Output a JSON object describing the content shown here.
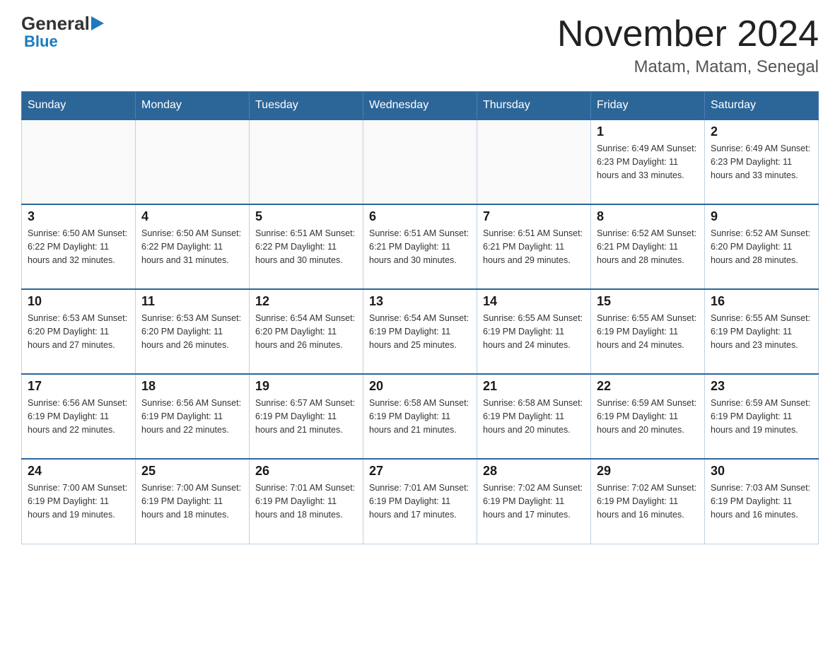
{
  "logo": {
    "general": "General",
    "blue": "Blue",
    "arrow_unicode": "▶"
  },
  "title": "November 2024",
  "subtitle": "Matam, Matam, Senegal",
  "weekdays": [
    "Sunday",
    "Monday",
    "Tuesday",
    "Wednesday",
    "Thursday",
    "Friday",
    "Saturday"
  ],
  "weeks": [
    {
      "days": [
        {
          "num": "",
          "info": ""
        },
        {
          "num": "",
          "info": ""
        },
        {
          "num": "",
          "info": ""
        },
        {
          "num": "",
          "info": ""
        },
        {
          "num": "",
          "info": ""
        },
        {
          "num": "1",
          "info": "Sunrise: 6:49 AM\nSunset: 6:23 PM\nDaylight: 11 hours and 33 minutes."
        },
        {
          "num": "2",
          "info": "Sunrise: 6:49 AM\nSunset: 6:23 PM\nDaylight: 11 hours and 33 minutes."
        }
      ]
    },
    {
      "days": [
        {
          "num": "3",
          "info": "Sunrise: 6:50 AM\nSunset: 6:22 PM\nDaylight: 11 hours and 32 minutes."
        },
        {
          "num": "4",
          "info": "Sunrise: 6:50 AM\nSunset: 6:22 PM\nDaylight: 11 hours and 31 minutes."
        },
        {
          "num": "5",
          "info": "Sunrise: 6:51 AM\nSunset: 6:22 PM\nDaylight: 11 hours and 30 minutes."
        },
        {
          "num": "6",
          "info": "Sunrise: 6:51 AM\nSunset: 6:21 PM\nDaylight: 11 hours and 30 minutes."
        },
        {
          "num": "7",
          "info": "Sunrise: 6:51 AM\nSunset: 6:21 PM\nDaylight: 11 hours and 29 minutes."
        },
        {
          "num": "8",
          "info": "Sunrise: 6:52 AM\nSunset: 6:21 PM\nDaylight: 11 hours and 28 minutes."
        },
        {
          "num": "9",
          "info": "Sunrise: 6:52 AM\nSunset: 6:20 PM\nDaylight: 11 hours and 28 minutes."
        }
      ]
    },
    {
      "days": [
        {
          "num": "10",
          "info": "Sunrise: 6:53 AM\nSunset: 6:20 PM\nDaylight: 11 hours and 27 minutes."
        },
        {
          "num": "11",
          "info": "Sunrise: 6:53 AM\nSunset: 6:20 PM\nDaylight: 11 hours and 26 minutes."
        },
        {
          "num": "12",
          "info": "Sunrise: 6:54 AM\nSunset: 6:20 PM\nDaylight: 11 hours and 26 minutes."
        },
        {
          "num": "13",
          "info": "Sunrise: 6:54 AM\nSunset: 6:19 PM\nDaylight: 11 hours and 25 minutes."
        },
        {
          "num": "14",
          "info": "Sunrise: 6:55 AM\nSunset: 6:19 PM\nDaylight: 11 hours and 24 minutes."
        },
        {
          "num": "15",
          "info": "Sunrise: 6:55 AM\nSunset: 6:19 PM\nDaylight: 11 hours and 24 minutes."
        },
        {
          "num": "16",
          "info": "Sunrise: 6:55 AM\nSunset: 6:19 PM\nDaylight: 11 hours and 23 minutes."
        }
      ]
    },
    {
      "days": [
        {
          "num": "17",
          "info": "Sunrise: 6:56 AM\nSunset: 6:19 PM\nDaylight: 11 hours and 22 minutes."
        },
        {
          "num": "18",
          "info": "Sunrise: 6:56 AM\nSunset: 6:19 PM\nDaylight: 11 hours and 22 minutes."
        },
        {
          "num": "19",
          "info": "Sunrise: 6:57 AM\nSunset: 6:19 PM\nDaylight: 11 hours and 21 minutes."
        },
        {
          "num": "20",
          "info": "Sunrise: 6:58 AM\nSunset: 6:19 PM\nDaylight: 11 hours and 21 minutes."
        },
        {
          "num": "21",
          "info": "Sunrise: 6:58 AM\nSunset: 6:19 PM\nDaylight: 11 hours and 20 minutes."
        },
        {
          "num": "22",
          "info": "Sunrise: 6:59 AM\nSunset: 6:19 PM\nDaylight: 11 hours and 20 minutes."
        },
        {
          "num": "23",
          "info": "Sunrise: 6:59 AM\nSunset: 6:19 PM\nDaylight: 11 hours and 19 minutes."
        }
      ]
    },
    {
      "days": [
        {
          "num": "24",
          "info": "Sunrise: 7:00 AM\nSunset: 6:19 PM\nDaylight: 11 hours and 19 minutes."
        },
        {
          "num": "25",
          "info": "Sunrise: 7:00 AM\nSunset: 6:19 PM\nDaylight: 11 hours and 18 minutes."
        },
        {
          "num": "26",
          "info": "Sunrise: 7:01 AM\nSunset: 6:19 PM\nDaylight: 11 hours and 18 minutes."
        },
        {
          "num": "27",
          "info": "Sunrise: 7:01 AM\nSunset: 6:19 PM\nDaylight: 11 hours and 17 minutes."
        },
        {
          "num": "28",
          "info": "Sunrise: 7:02 AM\nSunset: 6:19 PM\nDaylight: 11 hours and 17 minutes."
        },
        {
          "num": "29",
          "info": "Sunrise: 7:02 AM\nSunset: 6:19 PM\nDaylight: 11 hours and 16 minutes."
        },
        {
          "num": "30",
          "info": "Sunrise: 7:03 AM\nSunset: 6:19 PM\nDaylight: 11 hours and 16 minutes."
        }
      ]
    }
  ]
}
